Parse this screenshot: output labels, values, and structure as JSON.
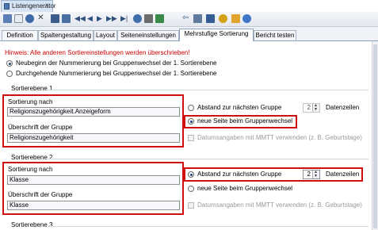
{
  "window": {
    "title": "Listengenerator",
    "close": "×"
  },
  "toolbar": {
    "icons": [
      "save-icon",
      "copy-icon",
      "undo-icon",
      "delete-icon",
      "new-icon",
      "list-icon",
      "first-icon",
      "prev-icon",
      "play-icon",
      "next-icon",
      "last-icon",
      "refresh-icon",
      "filter-icon",
      "table-icon",
      "back-icon",
      "print-icon",
      "settings-icon",
      "tip-icon",
      "export-icon",
      "help-icon"
    ]
  },
  "tabs": [
    {
      "label": "Definition"
    },
    {
      "label": "Spaltengestaltung"
    },
    {
      "label": "Layout"
    },
    {
      "label": "Seiteneinstellungen"
    },
    {
      "label": "Mehrstufige Sortierung"
    },
    {
      "label": "Bericht testen"
    }
  ],
  "hint": "Hinweis: Alle anderen Sortiereinstellungen werden überschrieben!",
  "numbering": {
    "option1": "Neubeginn der Nummerierung bei Gruppenwechsel der 1. Sortierebene",
    "option2": "Durchgehende Nummerierung bei Gruppenwechsel der 1. Sortierebene",
    "selected": 1
  },
  "levels": [
    {
      "title": "Sortierebene 1",
      "sort_label": "Sortierung nach",
      "sort_value": "Religionszugehörigkeit.Anzeigeform",
      "heading_label": "Überschrift der Gruppe",
      "heading_value": "Religionszugehörigkeit",
      "distance_label": "Abstand zur nächsten Gruppe",
      "distance_value": "2",
      "distance_unit": "Datenzeilen",
      "new_page_label": "neue Seite beim Gruppenwechsel",
      "selected": "new_page",
      "date_label": "Datumsangaben mit MMTT verwenden (z. B. Geburtstage)"
    },
    {
      "title": "Sortierebene 2",
      "sort_label": "Sortierung nach",
      "sort_value": "Klasse",
      "heading_label": "Überschrift der Gruppe",
      "heading_value": "Klasse",
      "distance_label": "Abstand zur nächsten Gruppe",
      "distance_value": "2",
      "distance_unit": "Datenzeilen",
      "new_page_label": "neue Seite beim Gruppenwechsel",
      "selected": "distance",
      "date_label": "Datumsangaben mit MMTT verwenden (z. B. Geburtstage)"
    },
    {
      "title": "Sortierebene 3"
    }
  ],
  "colors": {
    "highlight": "#d01010",
    "hint": "#cc0000",
    "accent": "#4b78b0"
  }
}
